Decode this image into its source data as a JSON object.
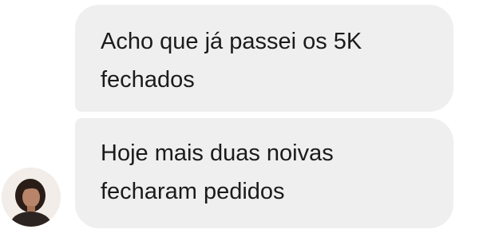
{
  "messages": [
    {
      "text": "Acho que já passei os 5K fechados"
    },
    {
      "text": "Hoje mais duas noivas fecharam pedidos"
    }
  ],
  "contact": {
    "avatar_icon": "profile-photo-avatar-icon"
  },
  "colors": {
    "bubble_background": "#efefef",
    "text": "#1b1b1b",
    "background": "#ffffff"
  }
}
